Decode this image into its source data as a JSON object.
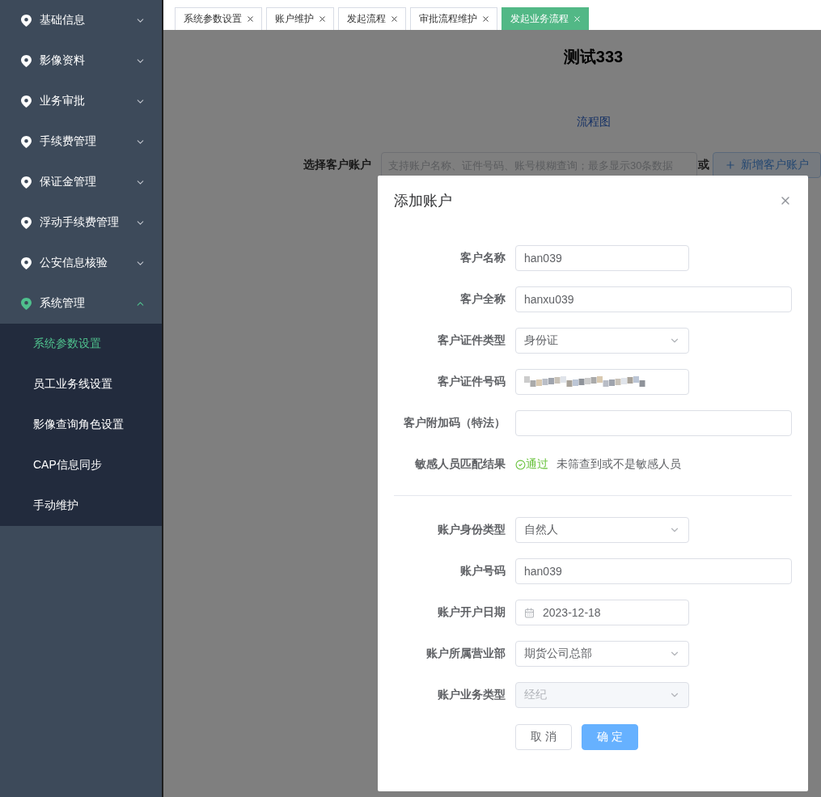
{
  "sidebar": {
    "items": [
      {
        "label": "基础信息",
        "expanded": false,
        "selected": false
      },
      {
        "label": "影像资料",
        "expanded": false,
        "selected": false
      },
      {
        "label": "业务审批",
        "expanded": false,
        "selected": false
      },
      {
        "label": "手续费管理",
        "expanded": false,
        "selected": false
      },
      {
        "label": "保证金管理",
        "expanded": false,
        "selected": false
      },
      {
        "label": "浮动手续费管理",
        "expanded": false,
        "selected": false
      },
      {
        "label": "公安信息核验",
        "expanded": false,
        "selected": false
      },
      {
        "label": "系统管理",
        "expanded": true,
        "selected": true,
        "children": [
          {
            "label": "系统参数设置",
            "selected": true
          },
          {
            "label": "员工业务线设置",
            "selected": false
          },
          {
            "label": "影像查询角色设置",
            "selected": false
          },
          {
            "label": "CAP信息同步",
            "selected": false
          },
          {
            "label": "手动维护",
            "selected": false
          }
        ]
      }
    ]
  },
  "tabs": [
    {
      "label": "系统参数设置",
      "selected": false
    },
    {
      "label": "账户维护",
      "selected": false
    },
    {
      "label": "发起流程",
      "selected": false
    },
    {
      "label": "审批流程维护",
      "selected": false
    },
    {
      "label": "发起业务流程",
      "selected": true
    }
  ],
  "page": {
    "title": "测试333",
    "link": "流程图",
    "account_picker": {
      "label": "选择客户账户",
      "placeholder": "支持账户名称、证件号码、账号模糊查询；最多显示30条数据"
    },
    "separator": "或",
    "add_button": "新增客户账户"
  },
  "dialog": {
    "title": "添加账户",
    "sections": [
      {
        "fields": [
          {
            "kind": "text",
            "label": "客户名称",
            "value": "han039",
            "wide": false
          },
          {
            "kind": "text",
            "label": "客户全称",
            "value": "hanxu039",
            "wide": true
          },
          {
            "kind": "select",
            "label": "客户证件类型",
            "value": "身份证",
            "disabled": false
          },
          {
            "kind": "redacted",
            "label": "客户证件号码"
          },
          {
            "kind": "text",
            "label": "客户附加码（特法）",
            "wide": true
          },
          {
            "kind": "result",
            "label": "敏感人员匹配结果",
            "status": "通过",
            "note": "未筛查到或不是敏感人员"
          }
        ]
      },
      {
        "fields": [
          {
            "kind": "select",
            "label": "账户身份类型",
            "value": "自然人",
            "disabled": false
          },
          {
            "kind": "text",
            "label": "账户号码",
            "value": "han039",
            "wide": true
          },
          {
            "kind": "date",
            "label": "账户开户日期",
            "value": "2023-12-18"
          },
          {
            "kind": "select",
            "label": "账户所属营业部",
            "value": "期货公司总部",
            "disabled": false
          },
          {
            "kind": "select",
            "label": "账户业务类型",
            "value": "经纪",
            "disabled": true
          }
        ]
      }
    ],
    "buttons": [
      {
        "label": "取 消",
        "primary": false
      },
      {
        "label": "确 定",
        "primary": true
      }
    ]
  }
}
